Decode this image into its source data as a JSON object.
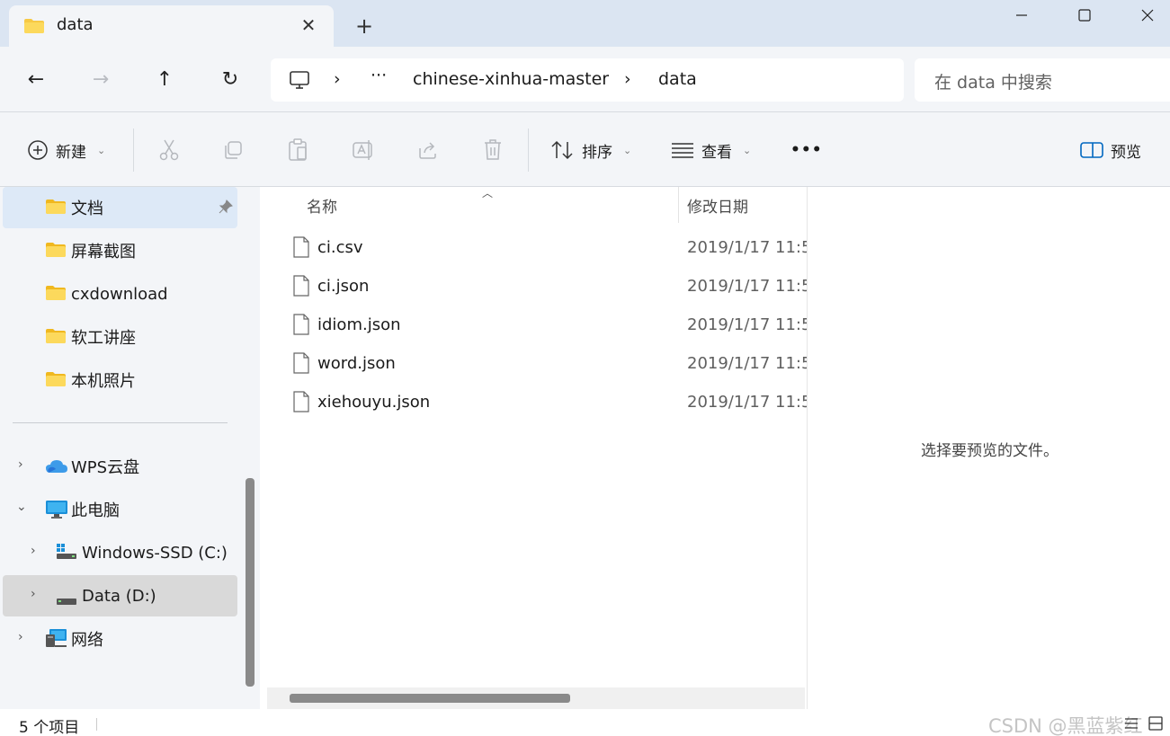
{
  "window": {
    "tab_title": "data",
    "tab_close": "✕",
    "new_tab": "+"
  },
  "nav": {
    "back": "←",
    "forward": "→",
    "up": "↑",
    "refresh": "↻",
    "breadcrumb_sep": "›",
    "breadcrumb_more": "···",
    "breadcrumbs": [
      "chinese-xinhua-master",
      "data"
    ],
    "search_placeholder": "在 data 中搜索"
  },
  "commandbar": {
    "new_label": "新建",
    "sort_label": "排序",
    "view_label": "查看",
    "more_label": "•••",
    "preview_label": "预览"
  },
  "sidebar": {
    "quick_access": [
      "文档",
      "屏幕截图",
      "cxdownload",
      "软工讲座",
      "本机照片"
    ],
    "wps_cloud": "WPS云盘",
    "this_pc": "此电脑",
    "drive_c": "Windows-SSD (C:)",
    "drive_d": "Data (D:)",
    "network": "网络"
  },
  "files": {
    "column_name": "名称",
    "column_date": "修改日期",
    "rows": [
      {
        "name": "ci.csv",
        "date": "2019/1/17 11:5"
      },
      {
        "name": "ci.json",
        "date": "2019/1/17 11:5"
      },
      {
        "name": "idiom.json",
        "date": "2019/1/17 11:5"
      },
      {
        "name": "word.json",
        "date": "2019/1/17 11:5"
      },
      {
        "name": "xiehouyu.json",
        "date": "2019/1/17 11:5"
      }
    ]
  },
  "preview": {
    "empty_text": "选择要预览的文件。"
  },
  "status": {
    "item_count": "5 个项目",
    "watermark": "CSDN @黑蓝紫红"
  },
  "colors": {
    "accent": "#0067c0",
    "folder": "#f7c944",
    "chrome_bg": "#f3f5f8",
    "titlebar_bg": "#dbe5f2"
  }
}
